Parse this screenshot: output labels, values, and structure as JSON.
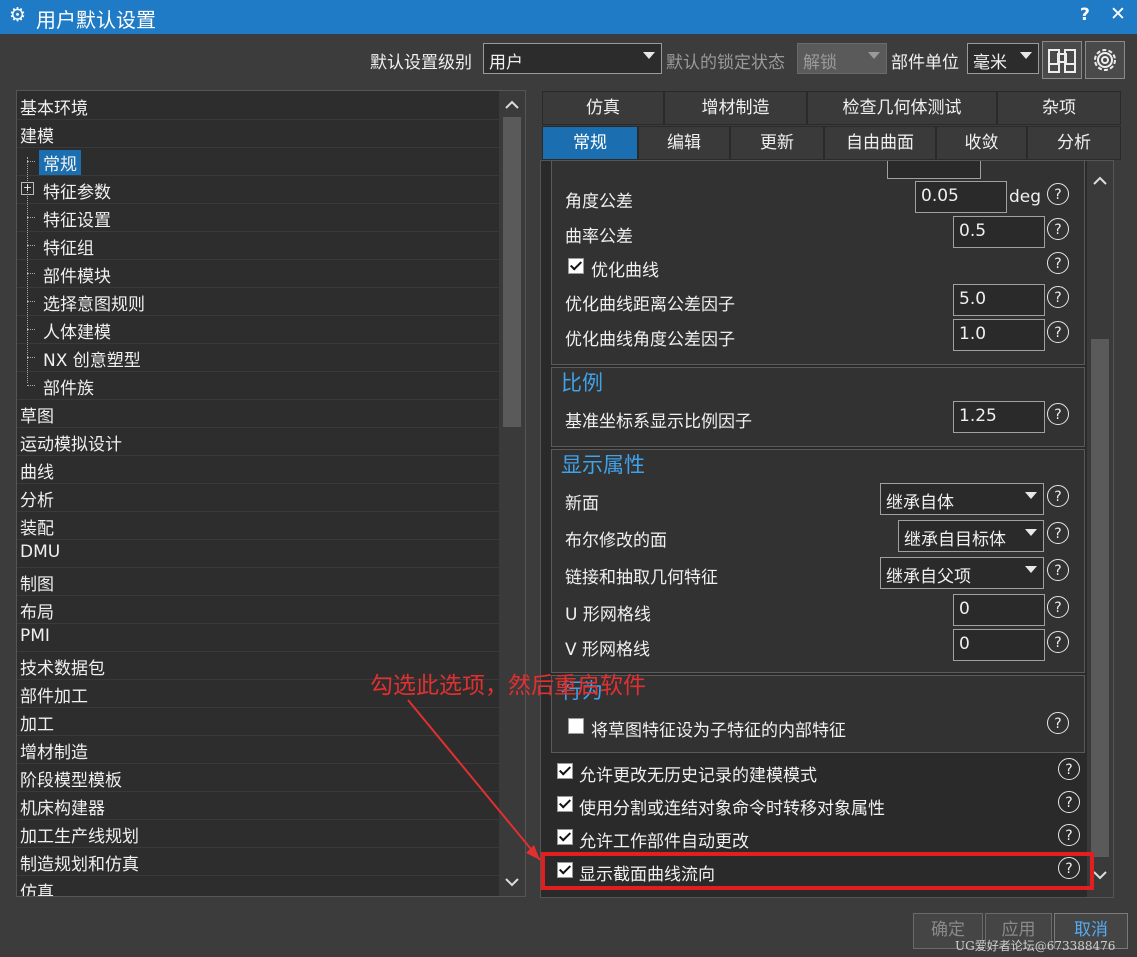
{
  "window": {
    "title": "用户默认设置",
    "help": "?",
    "close": "✕"
  },
  "toolbar": {
    "level_label": "默认设置级别",
    "level_value": "用户",
    "lock_label": "默认的锁定状态",
    "lock_value": "解锁",
    "unit_label": "部件单位",
    "unit_value": "毫米",
    "icons": [
      "binoculars-icon",
      "gear-icon"
    ]
  },
  "tree": {
    "items": [
      {
        "label": "基本环境",
        "level": 0
      },
      {
        "label": "建模",
        "level": 0
      },
      {
        "label": "常规",
        "level": 1,
        "selected": true
      },
      {
        "label": "特征参数",
        "level": 1,
        "expandable": true
      },
      {
        "label": "特征设置",
        "level": 1
      },
      {
        "label": "特征组",
        "level": 1
      },
      {
        "label": "部件模块",
        "level": 1
      },
      {
        "label": "选择意图规则",
        "level": 1
      },
      {
        "label": "人体建模",
        "level": 1
      },
      {
        "label": "NX 创意塑型",
        "level": 1
      },
      {
        "label": "部件族",
        "level": 1
      },
      {
        "label": "草图",
        "level": 0
      },
      {
        "label": "运动模拟设计",
        "level": 0
      },
      {
        "label": "曲线",
        "level": 0
      },
      {
        "label": "分析",
        "level": 0
      },
      {
        "label": "装配",
        "level": 0
      },
      {
        "label": "DMU",
        "level": 0
      },
      {
        "label": "制图",
        "level": 0
      },
      {
        "label": "布局",
        "level": 0
      },
      {
        "label": "PMI",
        "level": 0
      },
      {
        "label": "技术数据包",
        "level": 0
      },
      {
        "label": "部件加工",
        "level": 0
      },
      {
        "label": "加工",
        "level": 0
      },
      {
        "label": "增材制造",
        "level": 0
      },
      {
        "label": "阶段模型模板",
        "level": 0
      },
      {
        "label": "机床构建器",
        "level": 0
      },
      {
        "label": "加工生产线规划",
        "level": 0
      },
      {
        "label": "制造规划和仿真",
        "level": 0
      },
      {
        "label": "仿真",
        "level": 0
      }
    ]
  },
  "tabs_top": [
    "仿真",
    "增材制造",
    "检查几何体测试",
    "杂项"
  ],
  "tabs_bottom": [
    "常规",
    "编辑",
    "更新",
    "自由曲面",
    "收敛",
    "分析"
  ],
  "active_tab": "常规",
  "content": {
    "tolerance": {
      "angle_label": "角度公差",
      "angle_value": "0.05",
      "angle_unit": "deg",
      "curvature_label": "曲率公差",
      "curvature_value": "0.5",
      "optimize_label": "优化曲线",
      "optimize_checked": true,
      "opt_dist_label": "优化曲线距离公差因子",
      "opt_dist_value": "5.0",
      "opt_angle_label": "优化曲线角度公差因子",
      "opt_angle_value": "1.0"
    },
    "scale": {
      "title": "比例",
      "csys_label": "基准坐标系显示比例因子",
      "csys_value": "1.25"
    },
    "display": {
      "title": "显示属性",
      "new_face_label": "新面",
      "new_face_value": "继承自体",
      "boolean_label": "布尔修改的面",
      "boolean_value": "继承自目标体",
      "link_label": "链接和抽取几何特征",
      "link_value": "继承自父项",
      "u_label": "U 形网格线",
      "u_value": "0",
      "v_label": "V 形网格线",
      "v_value": "0"
    },
    "behavior": {
      "title": "行为",
      "sketch_internal_label": "将草图特征设为子特征的内部特征",
      "sketch_internal_checked": false
    },
    "options": [
      {
        "label": "允许更改无历史记录的建模模式",
        "checked": true
      },
      {
        "label": "使用分割或连结对象命令时转移对象属性",
        "checked": true
      },
      {
        "label": "允许工作部件自动更改",
        "checked": true
      },
      {
        "label": "显示截面曲线流向",
        "checked": true
      }
    ],
    "help_glyph": "?"
  },
  "buttons": {
    "ok": "确定",
    "apply": "应用",
    "cancel": "取消"
  },
  "annotation": {
    "text": "勾选此选项，然后重启软件",
    "color": "#e03030"
  },
  "watermark": "UG爱好者论坛@673388476"
}
